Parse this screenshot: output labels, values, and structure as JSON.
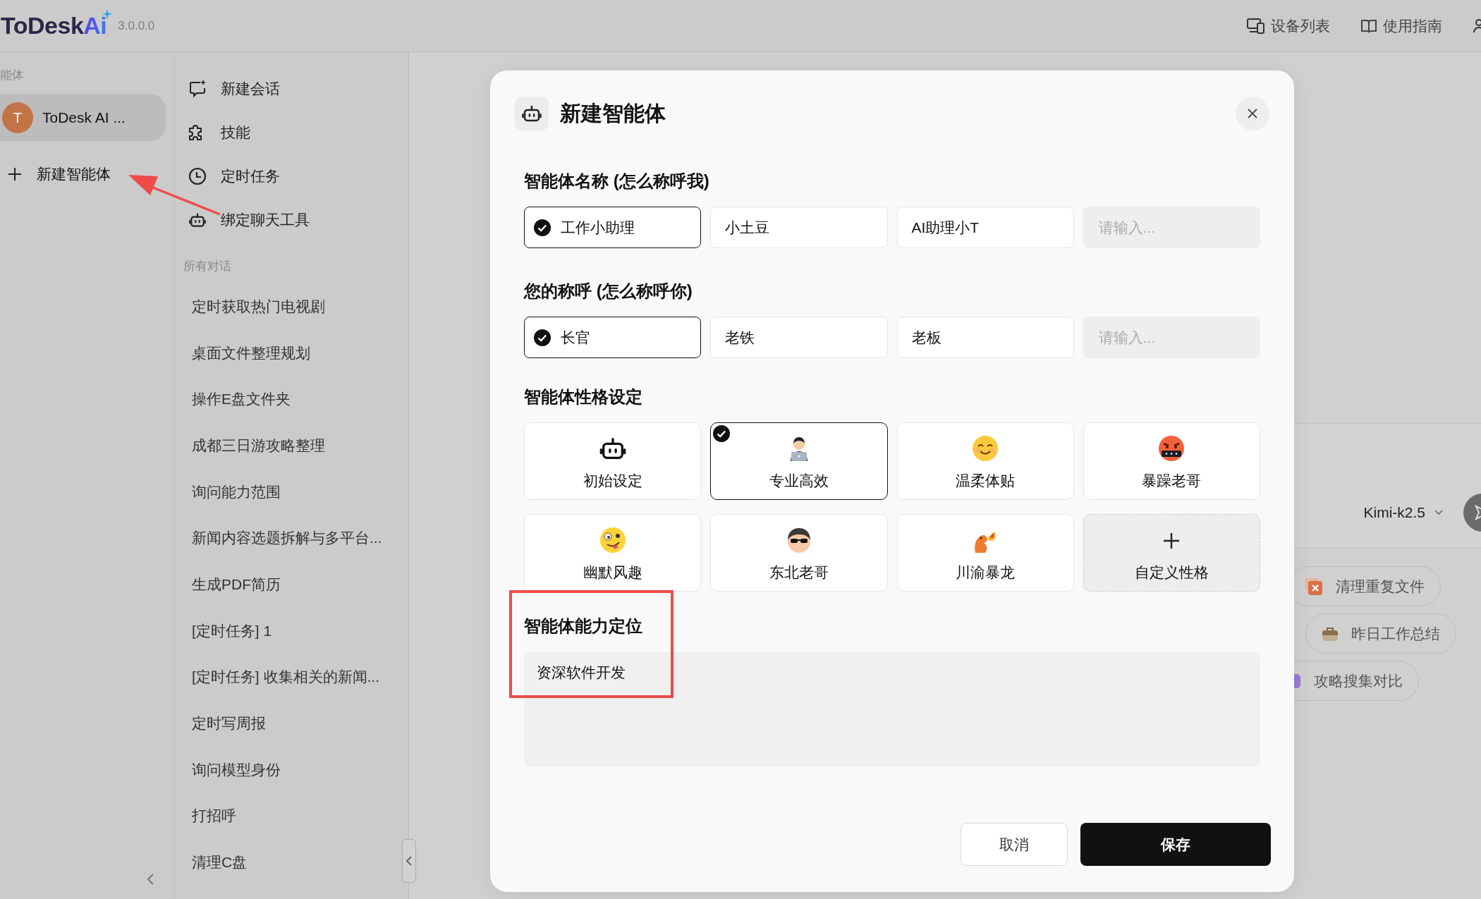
{
  "app": {
    "logo": "ToDesk",
    "logo_accent": "Ai",
    "version": "3.0.0.0",
    "top_links": [
      {
        "label": "设备列表"
      },
      {
        "label": "使用指南"
      }
    ]
  },
  "agents_panel": {
    "heading": "能体",
    "agents": [
      {
        "avatar": "T",
        "name": "ToDesk AI ...",
        "selected": true
      }
    ],
    "new_agent": "新建智能体"
  },
  "nav": {
    "items": [
      {
        "label": "新建会话"
      },
      {
        "label": "技能"
      },
      {
        "label": "定时任务"
      },
      {
        "label": "绑定聊天工具"
      }
    ],
    "history_heading": "所有对话",
    "conversations": [
      {
        "title": "定时获取热门电视剧"
      },
      {
        "title": "桌面文件整理规划"
      },
      {
        "title": "操作E盘文件夹"
      },
      {
        "title": "成都三日游攻略整理"
      },
      {
        "title": "询问能力范围"
      },
      {
        "title": "新闻内容选题拆解与多平台..."
      },
      {
        "title": "生成PDF简历"
      },
      {
        "title": "[定时任务] 1"
      },
      {
        "title": "[定时任务] 收集相关的新闻..."
      },
      {
        "title": "定时写周报"
      },
      {
        "title": "询问模型身份"
      },
      {
        "title": "打招呼"
      },
      {
        "title": "清理C盘"
      }
    ]
  },
  "chat": {
    "model": "Kimi-k2.5",
    "suggestions": [
      {
        "label": "清理重复文件"
      },
      {
        "label": "昨日工作总结"
      },
      {
        "label": "攻略搜集对比"
      }
    ]
  },
  "dialog": {
    "title": "新建智能体",
    "name_section": {
      "label": "智能体名称 (怎么称呼我)",
      "options": [
        {
          "label": "工作小助理",
          "selected": true
        },
        {
          "label": "小土豆",
          "selected": false
        },
        {
          "label": "AI助理小T",
          "selected": false
        }
      ],
      "placeholder": "请输入..."
    },
    "user_section": {
      "label": "您的称呼 (怎么称呼你)",
      "options": [
        {
          "label": "长官",
          "selected": true
        },
        {
          "label": "老铁",
          "selected": false
        },
        {
          "label": "老板",
          "selected": false
        }
      ],
      "placeholder": "请输入..."
    },
    "personality_section": {
      "label": "智能体性格设定",
      "options": [
        {
          "kind": "preset",
          "label": "初始设定",
          "selected": false
        },
        {
          "kind": "preset",
          "label": "专业高效",
          "selected": true
        },
        {
          "kind": "preset",
          "label": "温柔体贴",
          "selected": false
        },
        {
          "kind": "preset",
          "label": "暴躁老哥",
          "selected": false
        },
        {
          "kind": "preset",
          "label": "幽默风趣",
          "selected": false
        },
        {
          "kind": "preset",
          "label": "东北老哥",
          "selected": false
        },
        {
          "kind": "preset",
          "label": "川渝暴龙",
          "selected": false
        },
        {
          "kind": "custom",
          "label": "自定义性格",
          "selected": false
        }
      ]
    },
    "ability_section": {
      "label": "智能体能力定位",
      "value": "资深软件开发"
    },
    "buttons": [
      {
        "kind": "cancel",
        "label": "取消"
      },
      {
        "kind": "save",
        "label": "保存"
      }
    ]
  },
  "annotations": [
    {
      "kind": "arrow"
    },
    {
      "kind": "frame"
    }
  ]
}
